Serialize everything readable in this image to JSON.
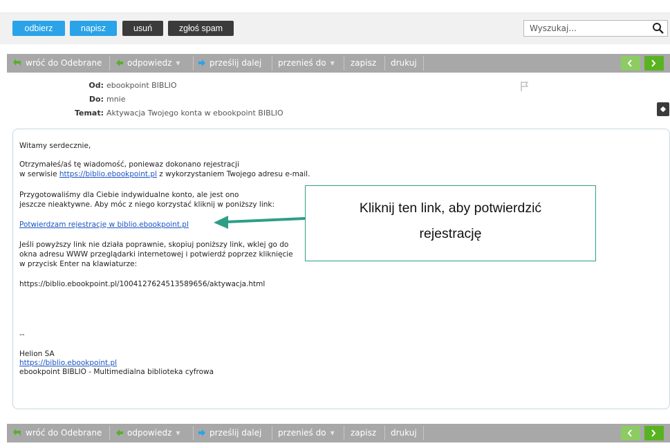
{
  "top_buttons": {
    "receive": "odbierz",
    "compose": "napisz",
    "delete": "usuń",
    "report_spam": "zgłoś spam"
  },
  "search": {
    "placeholder": "Wyszukaj..."
  },
  "toolbar": {
    "back": "wróć do Odebrane",
    "reply": "odpowiedz",
    "forward": "prześlij dalej",
    "move": "przenieś do",
    "save": "zapisz",
    "print": "drukuj"
  },
  "header": {
    "from_label": "Od:",
    "from_value": "ebookpoint BIBLIO",
    "to_label": "Do:",
    "to_value": "mnie",
    "subject_label": "Temat:",
    "subject_value": "Aktywacja Twojego konta w ebookpoint BIBLIO"
  },
  "message": {
    "greeting": "Witamy serdecznie,",
    "p1_l1": "Otrzymałeś/aś tę wiadomość, poniewaz dokonano rejestracji",
    "p1_l2_pre": "w serwisie ",
    "p1_l2_link": "https://biblio.ebookpoint.pl",
    "p1_l2_post": " z wykorzystaniem Twojego adresu e-mail.",
    "p2_l1": "Przygotowaliśmy dla Ciebie indywidualne konto, ale jest ono",
    "p2_l2": "jeszcze nieaktywne. Aby móc z niego korzystać kliknij w poniższy link:",
    "confirm_link": "Potwierdzam rejestrację w biblio.ebookpoint.pl",
    "p3_l1": "Jeśli powyższy link nie działa poprawnie, skopiuj poniższy link, wklej go do",
    "p3_l2": "okna adresu WWW przeglądarki internetowej i potwierdź poprzez kliknięcie",
    "p3_l3": "w przycisk Enter na klawiaturze:",
    "activation_url": "https://biblio.ebookpoint.pl/1004127624513589656/aktywacja.html",
    "sig_sep": "--",
    "sig_company": "Helion SA",
    "sig_link": "https://biblio.ebookpoint.pl",
    "sig_desc": "ebookpoint BIBLIO - Multimedialna biblioteka cyfrowa"
  },
  "callout": {
    "line1": "Kliknij ten link, aby potwierdzić",
    "line2": "rejestrację"
  },
  "colors": {
    "primary_button": "#2aa3e8",
    "dark_button": "#3b3b3b",
    "toolbar": "#a8a8a8",
    "nav_green": "#59b321",
    "link": "#1a54c4",
    "callout_border": "#2e9e86"
  }
}
